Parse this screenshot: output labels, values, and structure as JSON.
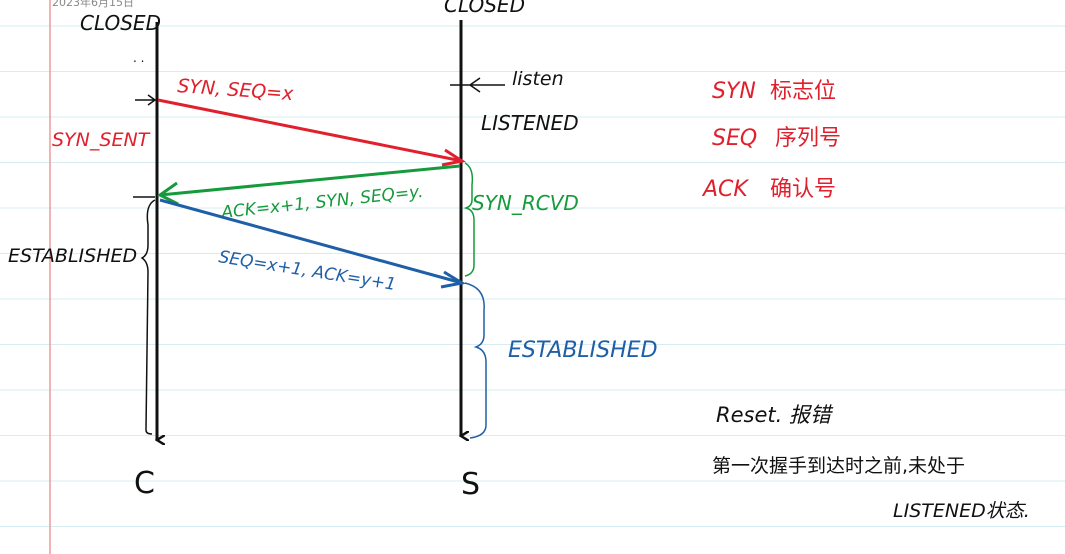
{
  "header": {
    "date_text": "2023年6月15日"
  },
  "colors": {
    "paper": "#ffffff",
    "rule_line": "#d7ecf3",
    "margin_line": "#ef9a9a",
    "ink_black": "#111111",
    "ink_red": "#e0202c",
    "ink_green": "#159a3c",
    "ink_blue": "#1f5fa8"
  },
  "client": {
    "initial_state": "CLOSED",
    "syn_sent_state": "SYN_SENT",
    "established_state": "ESTABLISHED",
    "endpoint_label": "C"
  },
  "server": {
    "initial_state": "CLOSED",
    "listen_note": "listen",
    "listened_state": "LISTENED",
    "syn_rcvd_state": "SYN_RCVD",
    "established_state": "ESTABLISHED",
    "endpoint_label": "S"
  },
  "messages": [
    {
      "label": "SYN, SEQ=x",
      "color": "red"
    },
    {
      "label": "ACK=x+1, SYN, SEQ=y.",
      "color": "green"
    },
    {
      "label": "SEQ=x+1, ACK=y+1",
      "color": "blue"
    }
  ],
  "legend": [
    {
      "term": "SYN",
      "meaning": "标志位"
    },
    {
      "term": "SEQ",
      "meaning": "序列号"
    },
    {
      "term": "ACK",
      "meaning": "确认号"
    }
  ],
  "note": {
    "line1": "Reset. 报错",
    "line2": "第一次握手到达时之前,未处于",
    "line3": "LISTENED状态."
  }
}
